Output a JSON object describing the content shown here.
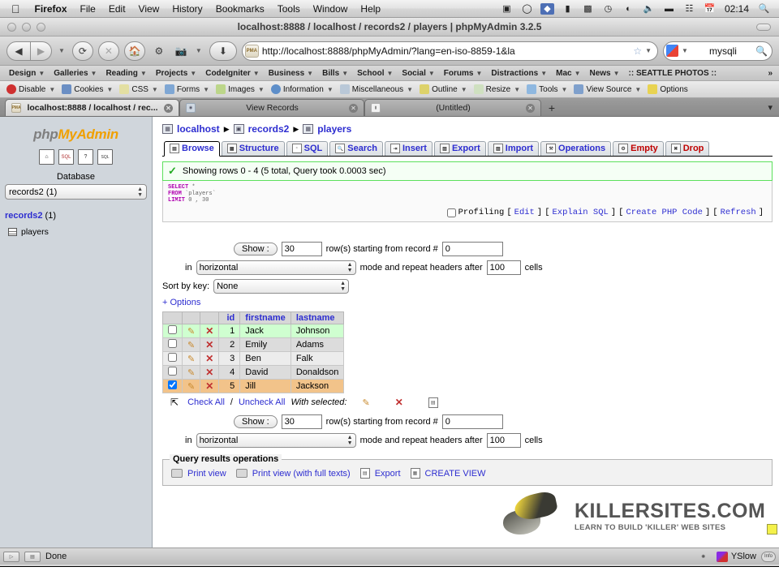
{
  "os_menubar": {
    "apple_icon": "apple-icon",
    "items": [
      "Firefox",
      "File",
      "Edit",
      "View",
      "History",
      "Bookmarks",
      "Tools",
      "Window",
      "Help"
    ],
    "status_icons": [
      "screen-recorder-icon",
      "timemachine-icon",
      "dropbox-icon",
      "display-icon",
      "dictionary-icon",
      "clock-history-icon",
      "wifi-icon",
      "volume-icon",
      "battery-icon",
      "spaces-icon",
      "calendar-icon"
    ],
    "clock": "02:14",
    "spotlight_icon": "search-icon"
  },
  "browser": {
    "window_title": "localhost:8888 / localhost / records2 / players | phpMyAdmin 3.2.5",
    "nav": {
      "back_icon": "back-arrow-icon",
      "forward_icon": "forward-arrow-icon",
      "reload_icon": "reload-icon",
      "stop_icon": "stop-icon",
      "home_icon": "home-icon",
      "gear_icon": "gear-icon",
      "camera_icon": "camera-icon",
      "download_icon": "download-icon"
    },
    "url": "http://localhost:8888/phpMyAdmin/?lang=en-iso-8859-1&la",
    "favicon": "pma-favicon",
    "star_icon": "bookmark-star-icon",
    "search": {
      "engine_icon": "google-icon",
      "value": "mysqli",
      "magnifier_icon": "search-icon"
    },
    "bookmarks": [
      "Design",
      "Galleries",
      "Reading",
      "Projects",
      "CodeIgniter",
      "Business",
      "Bills",
      "School",
      "Social",
      "Forums",
      "Distractions",
      "Mac",
      "News",
      ":: SEATTLE PHOTOS ::"
    ],
    "bookmarks_overflow_icon": "chevron-double-right-icon",
    "webdev_toolbar": [
      {
        "label": "Disable",
        "icon": "disable-icon",
        "color": "#cf3030"
      },
      {
        "label": "Cookies",
        "icon": "cookies-icon",
        "color": "#6b8fc4"
      },
      {
        "label": "CSS",
        "icon": "css-icon",
        "color": "#e3dfa2"
      },
      {
        "label": "Forms",
        "icon": "forms-icon",
        "color": "#7fa7d4"
      },
      {
        "label": "Images",
        "icon": "images-icon",
        "color": "#bcd68a"
      },
      {
        "label": "Information",
        "icon": "information-icon",
        "color": "#5d8ec9"
      },
      {
        "label": "Miscellaneous",
        "icon": "miscellaneous-icon",
        "color": "#b9c8d8"
      },
      {
        "label": "Outline",
        "icon": "outline-icon",
        "color": "#ddd26a"
      },
      {
        "label": "Resize",
        "icon": "resize-icon",
        "color": "#cfe0c0"
      },
      {
        "label": "Tools",
        "icon": "tools-icon",
        "color": "#8fb8e0"
      },
      {
        "label": "View Source",
        "icon": "view-source-icon",
        "color": "#7fa0cc"
      },
      {
        "label": "Options",
        "icon": "options-icon",
        "color": "#e8d352"
      }
    ],
    "tabs": [
      {
        "label": "localhost:8888 / localhost / rec...",
        "active": true,
        "favicon": "pma-favicon",
        "close_icon": "close-icon"
      },
      {
        "label": "View Records",
        "active": false,
        "favicon": "globe-icon",
        "close_icon": "close-icon"
      },
      {
        "label": "(Untitled)",
        "active": false,
        "favicon": "page-icon",
        "close_icon": "close-icon"
      }
    ],
    "new_tab_icon": "plus-icon",
    "tab_list_icon": "tab-list-icon",
    "status": {
      "text": "Done",
      "left_icons": [
        "cursor-icon",
        "inspector-icon"
      ],
      "right": {
        "firebug_icon": "firebug-icon",
        "yslow_icon": "yslow-icon",
        "yslow_label": "YSlow",
        "info_label": "Info"
      }
    }
  },
  "pma": {
    "logo": {
      "php": "php",
      "my": "My",
      "admin": "Admin"
    },
    "nav_icons": [
      {
        "name": "home-icon",
        "glyph": "⌂"
      },
      {
        "name": "sql-icon",
        "glyph": "SQL"
      },
      {
        "name": "help-icon",
        "glyph": "?"
      },
      {
        "name": "sql-help-icon",
        "glyph": "SQL"
      }
    ],
    "database_label": "Database",
    "database_select": "records2 (1)",
    "db_name": "records2",
    "db_count": "(1)",
    "tables": [
      "players"
    ],
    "breadcrumb": [
      {
        "label": "localhost",
        "icon": "server-icon"
      },
      {
        "label": "records2",
        "icon": "database-icon"
      },
      {
        "label": "players",
        "icon": "table-icon"
      }
    ],
    "tabs": [
      {
        "label": "Browse",
        "icon": "browse-icon",
        "active": true,
        "danger": false
      },
      {
        "label": "Structure",
        "icon": "structure-icon",
        "active": false,
        "danger": false
      },
      {
        "label": "SQL",
        "icon": "sql-icon",
        "active": false,
        "danger": false
      },
      {
        "label": "Search",
        "icon": "search-icon",
        "active": false,
        "danger": false
      },
      {
        "label": "Insert",
        "icon": "insert-icon",
        "active": false,
        "danger": false
      },
      {
        "label": "Export",
        "icon": "export-icon",
        "active": false,
        "danger": false
      },
      {
        "label": "Import",
        "icon": "import-icon",
        "active": false,
        "danger": false
      },
      {
        "label": "Operations",
        "icon": "operations-icon",
        "active": false,
        "danger": false
      },
      {
        "label": "Empty",
        "icon": "empty-icon",
        "active": false,
        "danger": true
      },
      {
        "label": "Drop",
        "icon": "drop-icon",
        "active": false,
        "danger": true
      }
    ],
    "result_message": "Showing rows 0 - 4 (5 total, Query took 0.0003 sec)",
    "result_check_icon": "checkmark-icon",
    "sql": {
      "line1_kw": "SELECT",
      "line1_rest": "*",
      "line2_kw": "FROM",
      "line2_rest": "`players`",
      "line3_kw": "LIMIT",
      "line3_rest": "0 , 30"
    },
    "sql_actions": {
      "profiling_label": "Profiling",
      "links": [
        "Edit",
        "Explain SQL",
        "Create PHP Code",
        "Refresh"
      ]
    },
    "controls_top": {
      "show_button": "Show :",
      "rows_value": "30",
      "starting_label": "row(s) starting from record #",
      "record_value": "0",
      "in_label": "in",
      "mode_value": "horizontal",
      "mode_label": "mode and repeat headers after",
      "headers_value": "100",
      "cells_label": "cells",
      "sort_label": "Sort by key:",
      "sort_value": "None",
      "options_link": "+ Options"
    },
    "controls_bottom": {
      "show_button": "Show :",
      "rows_value": "30",
      "starting_label": "row(s) starting from record #",
      "record_value": "0",
      "in_label": "in",
      "mode_value": "horizontal",
      "mode_label": "mode and repeat headers after",
      "headers_value": "100",
      "cells_label": "cells"
    },
    "table": {
      "columns": [
        "id",
        "firstname",
        "lastname"
      ],
      "rows": [
        {
          "id": "1",
          "firstname": "Jack",
          "lastname": "Johnson",
          "checked": false,
          "state": "hover"
        },
        {
          "id": "2",
          "firstname": "Emily",
          "lastname": "Adams",
          "checked": false,
          "state": "odd"
        },
        {
          "id": "3",
          "firstname": "Ben",
          "lastname": "Falk",
          "checked": false,
          "state": "even"
        },
        {
          "id": "4",
          "firstname": "David",
          "lastname": "Donaldson",
          "checked": false,
          "state": "odd"
        },
        {
          "id": "5",
          "firstname": "Jill",
          "lastname": "Jackson",
          "checked": true,
          "state": "selected"
        }
      ],
      "edit_icon": "pencil-icon",
      "delete_icon": "delete-x-icon"
    },
    "with_selected": {
      "arrow_icon": "arrow-up-left-icon",
      "check_all": "Check All",
      "separator": "/",
      "uncheck_all": "Uncheck All",
      "label": "With selected:",
      "edit_icon": "pencil-icon",
      "delete_icon": "delete-x-icon",
      "export_icon": "export-icon"
    },
    "query_ops": {
      "legend": "Query results operations",
      "items": [
        {
          "label": "Print view",
          "icon": "printer-icon"
        },
        {
          "label": "Print view (with full texts)",
          "icon": "printer-icon"
        },
        {
          "label": "Export",
          "icon": "export-icon"
        },
        {
          "label": "CREATE VIEW",
          "icon": "view-icon"
        }
      ]
    }
  },
  "watermark": {
    "title": "KILLERSITES.COM",
    "subtitle": "LEARN TO BUILD 'KILLER' WEB SITES",
    "frog_icon": "frog-logo-icon"
  },
  "colors": {
    "link": "#2d2dd0",
    "danger": "#c00000",
    "row_hover": "#cfffd0",
    "row_selected": "#f2c38a",
    "success_border": "#5ce05c",
    "accent_orange": "#f0a000"
  }
}
